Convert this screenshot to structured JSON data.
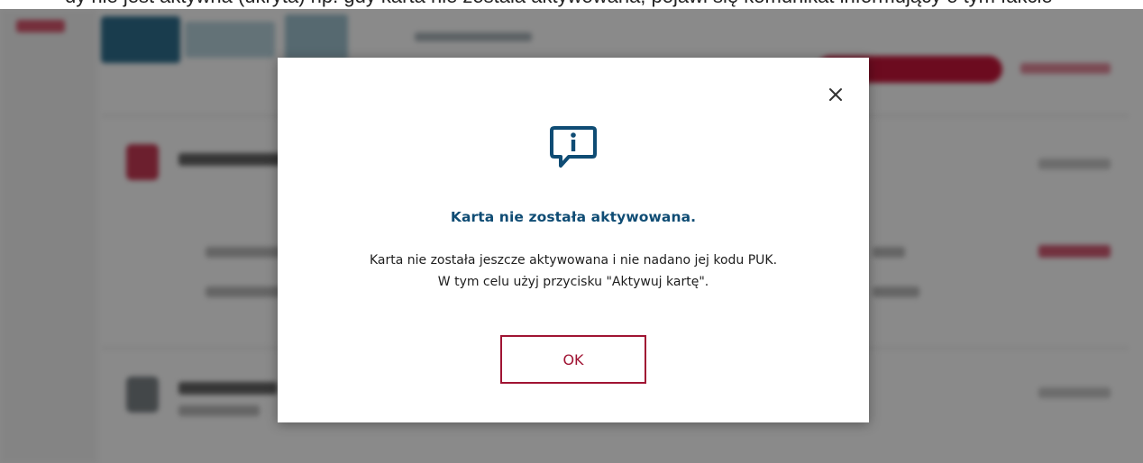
{
  "caption": {
    "text": "dy nie jest aktywna (ukryta) np. gdy karta nie została aktywowana, pojawi się komunikat informujący o tym fakcie"
  },
  "modal": {
    "close_icon": "close-icon",
    "info_icon": "info-chat-icon",
    "title": "Karta nie została aktywowana.",
    "body_line_1": "Karta nie została jeszcze aktywowana i nie nadano jej kodu PUK.",
    "body_line_2": "W tym celu użyj przycisku \"Aktywuj kartę\".",
    "ok_label": "OK"
  },
  "colors": {
    "title": "#0f4c74",
    "accent_red": "#a01433",
    "overlay": "rgba(0,0,0,0.46)"
  }
}
